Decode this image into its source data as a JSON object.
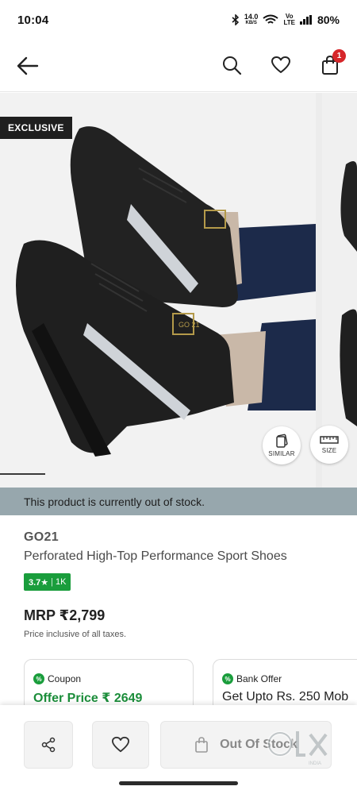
{
  "status_bar": {
    "time": "10:04",
    "speed_value": "14.0",
    "speed_unit": "KB/S",
    "volte_top": "Vo",
    "volte_bottom": "LTE",
    "battery": "80%"
  },
  "header": {
    "back_icon": "arrow-left-icon",
    "search_icon": "search-icon",
    "wishlist_icon": "heart-icon",
    "cart_icon": "shopping-bag-icon",
    "cart_count": "1"
  },
  "gallery": {
    "badge": "EXCLUSIVE",
    "similar_label": "SIMILAR",
    "size_label": "SIZE",
    "shoe_logo_text": "GO 21"
  },
  "stock_banner": "This product is currently out of stock.",
  "product": {
    "brand": "GO21",
    "name": "Perforated High-Top Performance Sport Shoes",
    "rating_value": "3.7★",
    "rating_separator": "|",
    "rating_count": "1K",
    "mrp": "MRP ₹2,799",
    "tax_note": "Price inclusive of all taxes."
  },
  "offers": [
    {
      "title": "Coupon",
      "value": "Offer Price ₹ 2649",
      "icon": "percent-icon"
    },
    {
      "title": "Bank Offer",
      "value": "Get Upto Rs. 250 Mob",
      "icon": "percent-icon"
    }
  ],
  "bottom_bar": {
    "share_icon": "share-icon",
    "wishlist_icon": "heart-icon",
    "oos_label": "Out Of Stock",
    "bag_icon": "bag-icon"
  },
  "watermark": {
    "text": "olx",
    "subtext": "INDIA"
  },
  "colors": {
    "accent_green": "#1a9d3c",
    "oos_banner": "#97a7ad",
    "badge_red": "#d6262a"
  }
}
